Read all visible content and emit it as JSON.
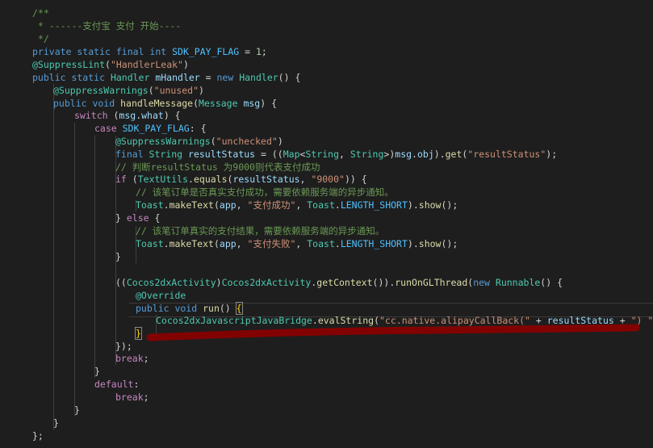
{
  "editor": {
    "lines": [
      [
        [
          "c",
          "/**"
        ]
      ],
      [
        [
          "c",
          " * ------支付宝 支付 开始----"
        ]
      ],
      [
        [
          "c",
          " */"
        ]
      ],
      [
        [
          "k",
          "private static final "
        ],
        [
          "k",
          "int "
        ],
        [
          "cn",
          "SDK_PAY_FLAG"
        ],
        [
          "p",
          " = "
        ],
        [
          "n",
          "1"
        ],
        [
          "p",
          ";"
        ]
      ],
      [
        [
          "t",
          "@SuppressLint"
        ],
        [
          "p",
          "("
        ],
        [
          "s",
          "\"HandlerLeak\""
        ],
        [
          "p",
          ")"
        ]
      ],
      [
        [
          "k",
          "public static "
        ],
        [
          "t",
          "Handler "
        ],
        [
          "v",
          "mHandler"
        ],
        [
          "p",
          " = "
        ],
        [
          "k",
          "new "
        ],
        [
          "t",
          "Handler"
        ],
        [
          "p",
          "() {"
        ]
      ],
      [
        [
          "t",
          "@SuppressWarnings"
        ],
        [
          "p",
          "("
        ],
        [
          "s",
          "\"unused\""
        ],
        [
          "p",
          ")"
        ]
      ],
      [
        [
          "k",
          "public void "
        ],
        [
          "f",
          "handleMessage"
        ],
        [
          "p",
          "("
        ],
        [
          "t",
          "Message "
        ],
        [
          "v",
          "msg"
        ],
        [
          "p",
          ") {"
        ]
      ],
      [
        [
          "cf",
          "switch "
        ],
        [
          "p",
          "("
        ],
        [
          "v",
          "msg"
        ],
        [
          "p",
          "."
        ],
        [
          "v",
          "what"
        ],
        [
          "p",
          ") {"
        ]
      ],
      [
        [
          "cf",
          "case "
        ],
        [
          "cn",
          "SDK_PAY_FLAG"
        ],
        [
          "p",
          ": {"
        ]
      ],
      [
        [
          "t",
          "@SuppressWarnings"
        ],
        [
          "p",
          "("
        ],
        [
          "s",
          "\"unchecked\""
        ],
        [
          "p",
          ")"
        ]
      ],
      [
        [
          "k",
          "final "
        ],
        [
          "t",
          "String "
        ],
        [
          "v",
          "resultStatus"
        ],
        [
          "p",
          " = (("
        ],
        [
          "t",
          "Map"
        ],
        [
          "p",
          "<"
        ],
        [
          "t",
          "String"
        ],
        [
          "p",
          ", "
        ],
        [
          "t",
          "String"
        ],
        [
          "p",
          ">)"
        ],
        [
          "v",
          "msg"
        ],
        [
          "p",
          "."
        ],
        [
          "v",
          "obj"
        ],
        [
          "p",
          ")."
        ],
        [
          "f",
          "get"
        ],
        [
          "p",
          "("
        ],
        [
          "s",
          "\"resultStatus\""
        ],
        [
          "p",
          ");"
        ]
      ],
      [
        [
          "c",
          "// 判断resultStatus 为9000则代表支付成功"
        ]
      ],
      [
        [
          "cf",
          "if "
        ],
        [
          "p",
          "("
        ],
        [
          "t",
          "TextUtils"
        ],
        [
          "p",
          "."
        ],
        [
          "f",
          "equals"
        ],
        [
          "p",
          "("
        ],
        [
          "v",
          "resultStatus"
        ],
        [
          "p",
          ", "
        ],
        [
          "s",
          "\"9000\""
        ],
        [
          "p",
          ")) {"
        ]
      ],
      [
        [
          "c",
          "// 该笔订单是否真实支付成功，需要依赖服务端的异步通知。"
        ]
      ],
      [
        [
          "t",
          "Toast"
        ],
        [
          "p",
          "."
        ],
        [
          "f",
          "makeText"
        ],
        [
          "p",
          "("
        ],
        [
          "v",
          "app"
        ],
        [
          "p",
          ", "
        ],
        [
          "s",
          "\"支付成功\""
        ],
        [
          "p",
          ", "
        ],
        [
          "t",
          "Toast"
        ],
        [
          "p",
          "."
        ],
        [
          "cn",
          "LENGTH_SHORT"
        ],
        [
          "p",
          ")."
        ],
        [
          "f",
          "show"
        ],
        [
          "p",
          "();"
        ]
      ],
      [
        [
          "p",
          "} "
        ],
        [
          "cf",
          "else "
        ],
        [
          "p",
          "{"
        ]
      ],
      [
        [
          "c",
          "// 该笔订单真实的支付结果，需要依赖服务端的异步通知。"
        ]
      ],
      [
        [
          "t",
          "Toast"
        ],
        [
          "p",
          "."
        ],
        [
          "f",
          "makeText"
        ],
        [
          "p",
          "("
        ],
        [
          "v",
          "app"
        ],
        [
          "p",
          ", "
        ],
        [
          "s",
          "\"支付失败\""
        ],
        [
          "p",
          ", "
        ],
        [
          "t",
          "Toast"
        ],
        [
          "p",
          "."
        ],
        [
          "cn",
          "LENGTH_SHORT"
        ],
        [
          "p",
          ")."
        ],
        [
          "f",
          "show"
        ],
        [
          "p",
          "();"
        ]
      ],
      [
        [
          "p",
          "}"
        ]
      ],
      [],
      [
        [
          "p",
          "(("
        ],
        [
          "t",
          "Cocos2dxActivity"
        ],
        [
          "p",
          ")"
        ],
        [
          "t",
          "Cocos2dxActivity"
        ],
        [
          "p",
          "."
        ],
        [
          "f",
          "getContext"
        ],
        [
          "p",
          "())."
        ],
        [
          "f",
          "runOnGLThread"
        ],
        [
          "p",
          "("
        ],
        [
          "k",
          "new "
        ],
        [
          "t",
          "Runnable"
        ],
        [
          "p",
          "() {"
        ]
      ],
      [
        [
          "t",
          "@Override"
        ]
      ],
      [
        [
          "k",
          "public void "
        ],
        [
          "f",
          "run"
        ],
        [
          "p",
          "() "
        ],
        [
          "br",
          "{"
        ]
      ],
      [
        [
          "t",
          "Cocos2dxJavascriptJavaBridge"
        ],
        [
          "p",
          "."
        ],
        [
          "f",
          "evalString"
        ],
        [
          "p",
          "("
        ],
        [
          "s",
          "\"cc.native.alipayCallBack(\""
        ],
        [
          "p",
          " + "
        ],
        [
          "v",
          "resultStatus"
        ],
        [
          "p",
          " + "
        ],
        [
          "s",
          "\") \""
        ],
        [
          "p",
          ");"
        ]
      ],
      [
        [
          "br",
          "}"
        ]
      ],
      [
        [
          "p",
          "});"
        ]
      ],
      [
        [
          "cf",
          "break"
        ],
        [
          "p",
          ";"
        ]
      ],
      [
        [
          "p",
          "}"
        ]
      ],
      [
        [
          "cf",
          "default"
        ],
        [
          "p",
          ":"
        ]
      ],
      [
        [
          "cf",
          "break"
        ],
        [
          "p",
          ";"
        ]
      ],
      [
        [
          "p",
          "}"
        ]
      ],
      [
        [
          "p",
          "}"
        ]
      ],
      [
        [
          "p",
          "};"
        ]
      ]
    ]
  }
}
